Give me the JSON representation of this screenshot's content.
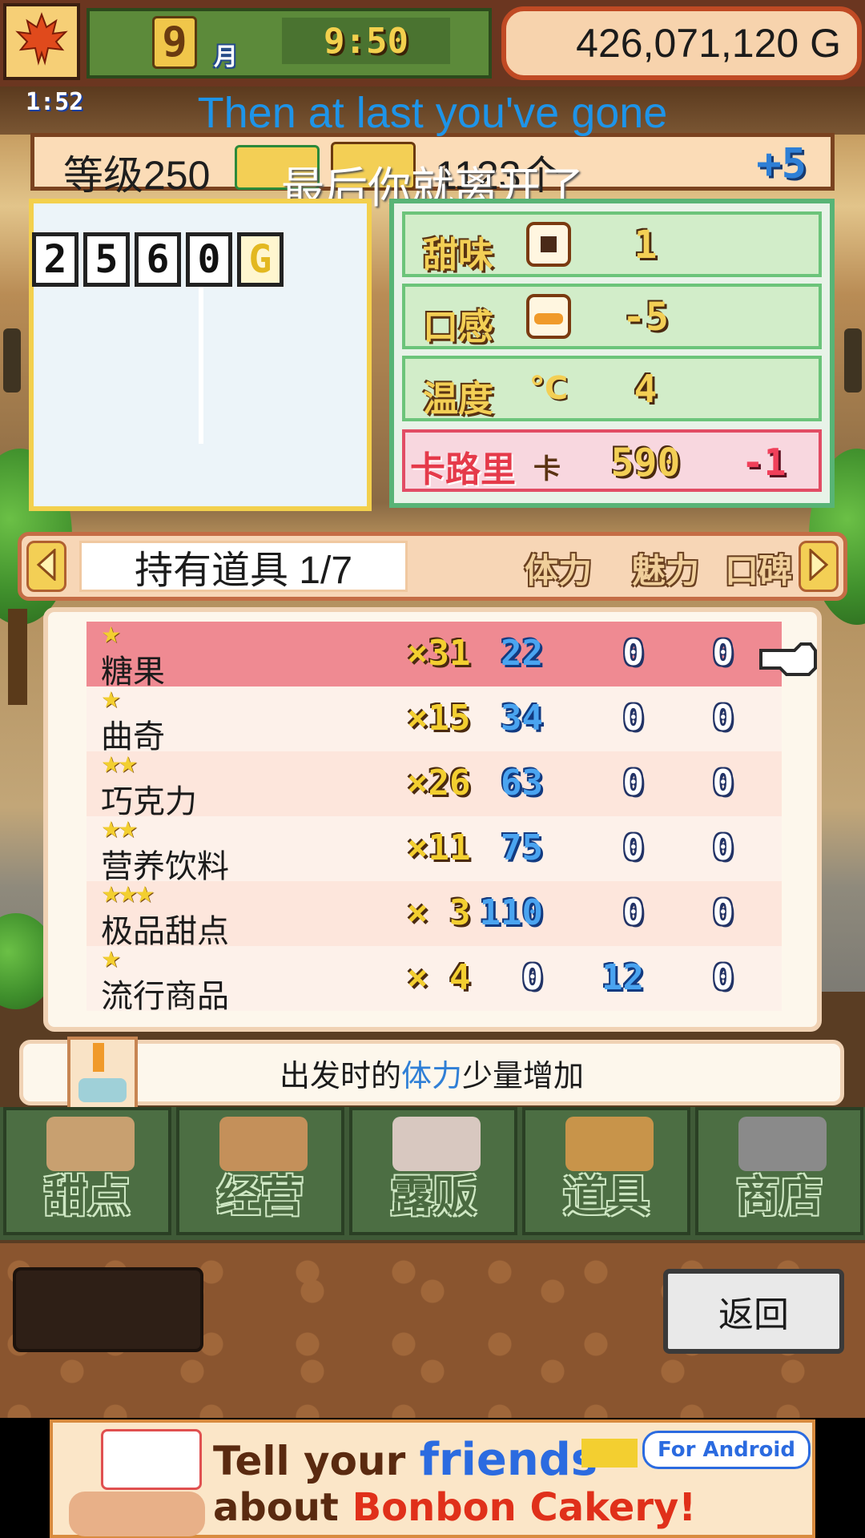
{
  "top_bar": {
    "month_number": "9",
    "month_label": "月",
    "time": "9:50",
    "money": "426,071,120 G"
  },
  "subtitles": {
    "timestamp": "1:52",
    "english": "Then at last you've gone",
    "chinese": "最后你就离开了"
  },
  "level_bar": {
    "level": "等级250",
    "rank_text": "1123个",
    "plus": "+5"
  },
  "price": {
    "digits": [
      "2",
      "5",
      "6",
      "0"
    ],
    "currency": "G"
  },
  "stats": {
    "sweetness": {
      "label": "甜味",
      "value": "1"
    },
    "texture": {
      "label": "口感",
      "value": "-5"
    },
    "temperature": {
      "label": "温度",
      "unit": "℃",
      "value": "4"
    },
    "calories": {
      "label": "卡路里",
      "unit": "卡",
      "value": "590",
      "delta": "-1"
    }
  },
  "items_header": {
    "title": "持有道具 1/7",
    "col_stamina": "体力",
    "col_charm": "魅力",
    "col_reputation": "口碑"
  },
  "items": [
    {
      "stars": "★",
      "name": "糖果",
      "qty": "×31",
      "stamina": "22",
      "charm": "0",
      "reputation": "0"
    },
    {
      "stars": "★",
      "name": "曲奇",
      "qty": "×15",
      "stamina": "34",
      "charm": "0",
      "reputation": "0"
    },
    {
      "stars": "★★",
      "name": "巧克力",
      "qty": "×26",
      "stamina": "63",
      "charm": "0",
      "reputation": "0"
    },
    {
      "stars": "★★",
      "name": "营养饮料",
      "qty": "×11",
      "stamina": "75",
      "charm": "0",
      "reputation": "0"
    },
    {
      "stars": "★★★",
      "name": "极品甜点",
      "qty": "× 3",
      "stamina": "110",
      "charm": "0",
      "reputation": "0"
    },
    {
      "stars": "★",
      "name": "流行商品",
      "qty": "× 4",
      "stamina": "0",
      "charm": "12",
      "reputation": "0"
    }
  ],
  "description": {
    "prefix": "出发时的",
    "keyword": "体力",
    "suffix": "少量增加"
  },
  "nav": {
    "dessert": "甜点",
    "manage": "经营",
    "stall": "露贩",
    "items": "道具",
    "shop": "商店"
  },
  "back_button": "返回",
  "ad": {
    "line1_a": "Tell your ",
    "line1_b": "friends",
    "line2_a": "about ",
    "line2_b": "Bonbon Cakery!",
    "badge": "For Android"
  },
  "colors": {
    "selected_row": "#ef8a92",
    "stat_panel_border": "#58b476",
    "calorie_red": "#e53a4a",
    "stamina_blue": "#4aa4f0"
  }
}
